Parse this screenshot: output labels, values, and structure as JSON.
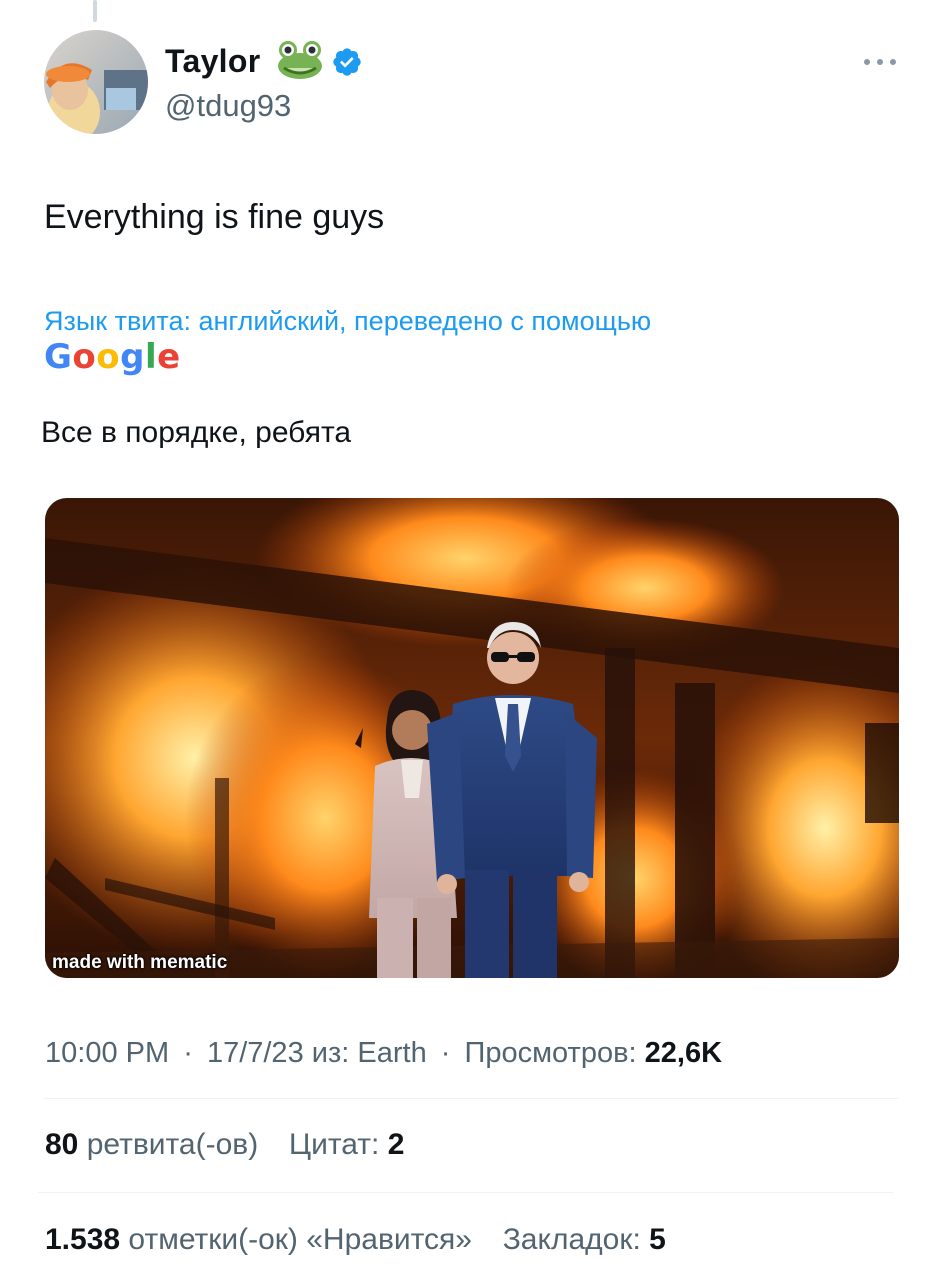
{
  "author": {
    "display_name": "Taylor",
    "handle": "@tdug93",
    "name_emoji": "frog-icon",
    "verified_icon": "verified-badge-icon"
  },
  "tweet": {
    "text": "Everything is fine guys",
    "translation_note": "Язык твита: английский, переведено с помощью",
    "translation_provider": "Google",
    "translated_text": "Все в порядке, ребята",
    "media_watermark": "made with mematic"
  },
  "meta": {
    "time": "10:00 PM",
    "date": "17/7/23",
    "source_prefix": "из:",
    "source": "Earth",
    "views_label": "Просмотров:",
    "views_count": "22,6K"
  },
  "stats": {
    "retweets_count": "80",
    "retweets_label": "ретвита(-ов)",
    "quotes_label": "Цитат:",
    "quotes_count": "2",
    "likes_count": "1.538",
    "likes_label": "отметки(-ок) «Нравится»",
    "bookmarks_label": "Закладок:",
    "bookmarks_count": "5"
  },
  "colors": {
    "link_blue": "#1d9bf0",
    "secondary_text": "#536471",
    "primary_text": "#0f1419",
    "verified_blue": "#1d9bf0"
  }
}
